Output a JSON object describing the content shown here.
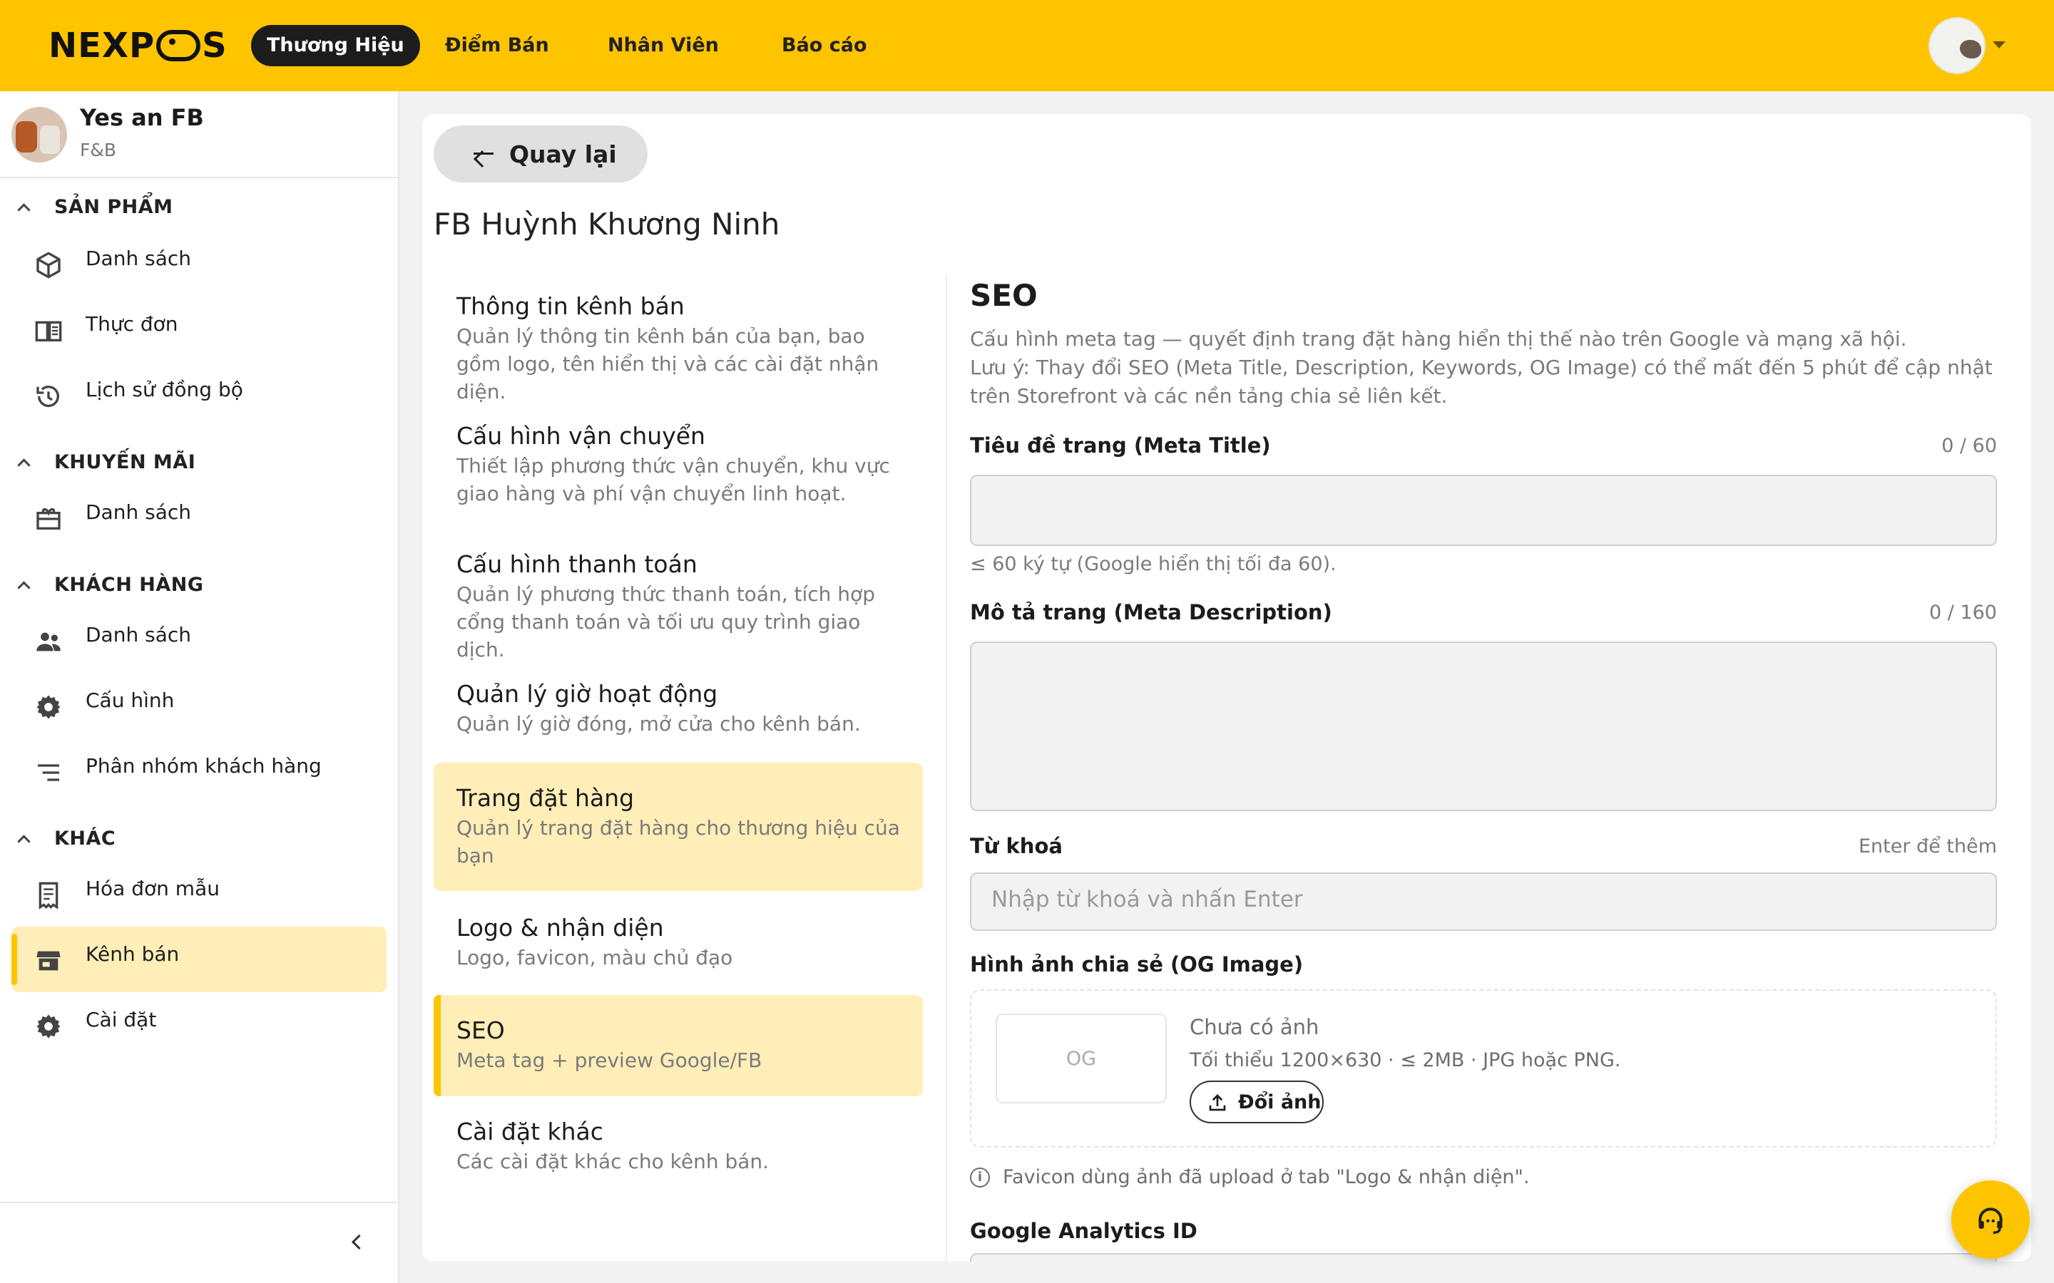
{
  "header": {
    "logo_text_left": "NEXP",
    "logo_text_right": "S",
    "nav": [
      {
        "label": "Thương Hiệu",
        "active": true
      },
      {
        "label": "Điểm Bán",
        "active": false
      },
      {
        "label": "Nhân Viên",
        "active": false
      },
      {
        "label": "Báo cáo",
        "active": false
      }
    ],
    "accent_color": "#ffc400"
  },
  "sidebar": {
    "brand_name": "Yes an FB",
    "brand_category": "F&B",
    "sections": [
      {
        "title": "SẢN PHẨM",
        "items": [
          {
            "label": "Danh sách",
            "icon": "box-icon"
          },
          {
            "label": "Thực đơn",
            "icon": "menu-book-icon"
          },
          {
            "label": "Lịch sử đồng bộ",
            "icon": "history-icon"
          }
        ]
      },
      {
        "title": "KHUYẾN MÃI",
        "items": [
          {
            "label": "Danh sách",
            "icon": "gift-card-icon"
          }
        ]
      },
      {
        "title": "KHÁCH HÀNG",
        "items": [
          {
            "label": "Danh sách",
            "icon": "people-icon"
          },
          {
            "label": "Cấu hình",
            "icon": "gear-icon"
          },
          {
            "label": "Phân nhóm khách hàng",
            "icon": "sort-lines-icon"
          }
        ]
      },
      {
        "title": "KHÁC",
        "items": [
          {
            "label": "Hóa đơn mẫu",
            "icon": "receipt-icon"
          },
          {
            "label": "Kênh bán",
            "icon": "store-icon",
            "active": true
          },
          {
            "label": "Cài đặt",
            "icon": "gear-icon"
          }
        ]
      }
    ]
  },
  "main": {
    "back_label": "Quay lại",
    "page_title": "FB Huỳnh Khương Ninh",
    "settings_nav": [
      {
        "title": "Thông tin kênh bán",
        "desc": "Quản lý thông tin kênh bán của bạn, bao gồm logo, tên hiển thị và các cài đặt nhận diện."
      },
      {
        "title": "Cấu hình vận chuyển",
        "desc": "Thiết lập phương thức vận chuyển, khu vực giao hàng và phí vận chuyển linh hoạt."
      },
      {
        "title": "Cấu hình thanh toán",
        "desc": "Quản lý phương thức thanh toán, tích hợp cổng thanh toán và tối ưu quy trình giao dịch."
      },
      {
        "title": "Quản lý giờ hoạt động",
        "desc": "Quản lý giờ đóng, mở cửa cho kênh bán."
      },
      {
        "title": "Trang đặt hàng",
        "desc": "Quản lý trang đặt hàng cho thương hiệu của bạn"
      },
      {
        "title": "Logo & nhận diện",
        "desc": "Logo, favicon, màu chủ đạo"
      },
      {
        "title": "SEO",
        "desc": "Meta tag + preview Google/FB"
      },
      {
        "title": "Cài đặt khác",
        "desc": "Các cài đặt khác cho kênh bán."
      }
    ],
    "seo": {
      "title": "SEO",
      "desc_line1": "Cấu hình meta tag — quyết định trang đặt hàng hiển thị thế nào trên Google và mạng xã hội.",
      "desc_line2": "Lưu ý: Thay đổi SEO (Meta Title, Description, Keywords, OG Image) có thể mất đến 5 phút để cập nhật trên Storefront và các nền tảng chia sẻ liên kết.",
      "meta_title_label": "Tiêu đề trang (Meta Title)",
      "meta_title_count": "0 / 60",
      "meta_title_value": "",
      "meta_title_hint": "≤ 60 ký tự (Google hiển thị tối đa 60).",
      "meta_desc_label": "Mô tả trang (Meta Description)",
      "meta_desc_count": "0 / 160",
      "meta_desc_value": "",
      "keywords_label": "Từ khoá",
      "keywords_hint": "Enter để thêm",
      "keywords_placeholder": "Nhập từ khoá và nhấn Enter",
      "og_label": "Hình ảnh chia sẻ (OG Image)",
      "og_thumb_text": "OG",
      "og_status": "Chưa có ảnh",
      "og_requirements": "Tối thiểu 1200×630 · ≤ 2MB · JPG hoặc PNG.",
      "og_button": "Đổi ảnh",
      "favicon_note": "Favicon dùng ảnh đã upload ở tab \"Logo & nhận diện\".",
      "ga_label": "Google Analytics ID"
    }
  }
}
